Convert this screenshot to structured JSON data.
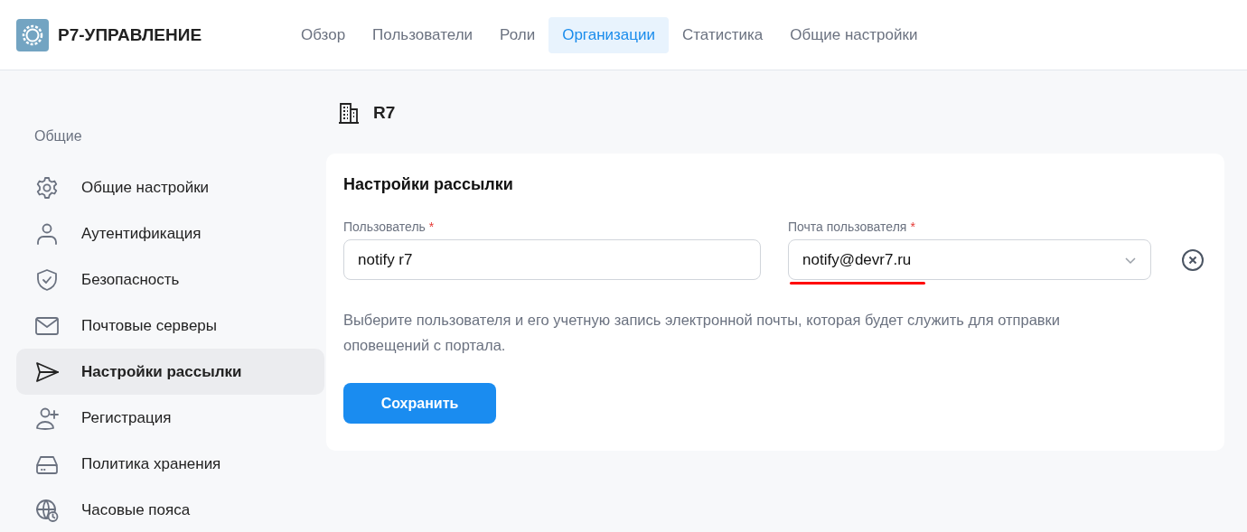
{
  "header": {
    "logo_text": "Р7-УПРАВЛЕНИЕ",
    "nav": [
      {
        "label": "Обзор",
        "selected": false
      },
      {
        "label": "Пользователи",
        "selected": false
      },
      {
        "label": "Роли",
        "selected": false
      },
      {
        "label": "Организации",
        "selected": true
      },
      {
        "label": "Статистика",
        "selected": false
      },
      {
        "label": "Общие настройки",
        "selected": false
      }
    ]
  },
  "sidebar": {
    "section": "Общие",
    "items": [
      {
        "label": "Общие настройки",
        "kind": "gear",
        "selected": false
      },
      {
        "label": "Аутентификация",
        "kind": "user",
        "selected": false
      },
      {
        "label": "Безопасность",
        "kind": "shield",
        "selected": false
      },
      {
        "label": "Почтовые серверы",
        "kind": "mail",
        "selected": false
      },
      {
        "label": "Настройки рассылки",
        "kind": "send",
        "selected": true
      },
      {
        "label": "Регистрация",
        "kind": "user-plus",
        "selected": false
      },
      {
        "label": "Политика хранения",
        "kind": "drive",
        "selected": false
      },
      {
        "label": "Часовые пояса",
        "kind": "globe-clock",
        "selected": false
      }
    ]
  },
  "org": {
    "name": "R7"
  },
  "card": {
    "title": "Настройки рассылки",
    "fields": [
      {
        "kind": "text",
        "label": "Пользователь",
        "required_mark": "*",
        "value": "notify r7",
        "underlined": false
      },
      {
        "kind": "select",
        "label": "Почта пользователя",
        "required_mark": "*",
        "value": "notify@devr7.ru",
        "underlined": true
      }
    ],
    "hint": "Выберите пользователя и его учетную запись электронной почты, которая будет служить для отправки оповещений с портала.",
    "save_button": "Сохранить"
  }
}
